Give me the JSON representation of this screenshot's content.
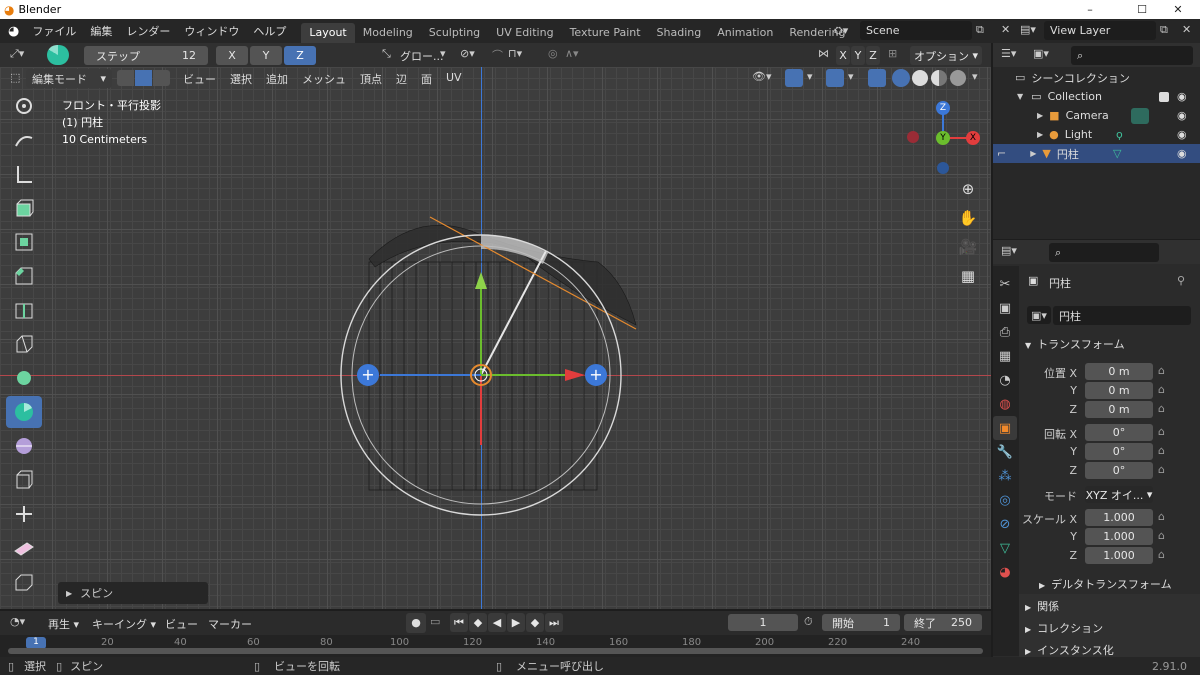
{
  "window": {
    "title": "Blender",
    "minimize": "–",
    "maximize": "☐",
    "close": "✕"
  },
  "menubar": {
    "items": [
      "ファイル",
      "編集",
      "レンダー",
      "ウィンドウ",
      "ヘルプ"
    ],
    "workspaces": [
      "Layout",
      "Modeling",
      "Sculpting",
      "UV Editing",
      "Texture Paint",
      "Shading",
      "Animation",
      "Rendering"
    ],
    "active_workspace": "Layout",
    "scene": "Scene",
    "view_layer": "View Layer"
  },
  "tool_settings": {
    "steps_label": "ステップ",
    "steps_value": "12",
    "axes": [
      "X",
      "Y",
      "Z"
    ],
    "active_axis": "Z",
    "orientation": "グロー...",
    "options": "オプション",
    "snap_axes": [
      "X",
      "Y",
      "Z"
    ]
  },
  "viewport_header": {
    "mode": "編集モード",
    "menus": [
      "ビュー",
      "選択",
      "追加",
      "メッシュ",
      "頂点",
      "辺",
      "面",
      "UV"
    ]
  },
  "viewport": {
    "view_name": "フロント・平行投影",
    "object_name": "(1) 円柱",
    "scale": "10 Centimeters",
    "gizmo": {
      "z": "Z",
      "y": "Y",
      "x": "X"
    },
    "last_op_panel": "スピン"
  },
  "outliner": {
    "scene_collection": "シーンコレクション",
    "items": [
      {
        "name": "Collection",
        "icon": "collection-icon"
      },
      {
        "name": "Camera",
        "icon": "camera-icon"
      },
      {
        "name": "Light",
        "icon": "light-icon"
      },
      {
        "name": "円柱",
        "icon": "mesh-icon"
      }
    ]
  },
  "properties": {
    "object_name_header": "円柱",
    "object_name_field": "円柱",
    "transform_header": "トランスフォーム",
    "location_label": "位置 X",
    "location": [
      "0 m",
      "0 m",
      "0 m"
    ],
    "rotation_label": "回転 X",
    "rotation": [
      "0°",
      "0°",
      "0°"
    ],
    "mode_label": "モード",
    "mode_value": "XYZ オイ...",
    "scale_label": "スケール X",
    "scale": [
      "1.000",
      "1.000",
      "1.000"
    ],
    "axis_y": "Y",
    "axis_z": "Z",
    "delta_transform": "デルタトランスフォーム",
    "sections": [
      "関係",
      "コレクション",
      "インスタンス化"
    ]
  },
  "timeline": {
    "playback": "再生",
    "keying": "キーイング",
    "view": "ビュー",
    "marker": "マーカー",
    "current_frame": "1",
    "start_label": "開始",
    "start": "1",
    "end_label": "終了",
    "end": "250",
    "ruler_current": "1",
    "ruler": [
      "20",
      "40",
      "60",
      "80",
      "100",
      "120",
      "140",
      "160",
      "180",
      "200",
      "220",
      "240"
    ]
  },
  "statusbar": {
    "select": "選択",
    "spin": "スピン",
    "rotate_view": "ビューを回転",
    "call_menu": "メニュー呼び出し",
    "version": "2.91.0"
  },
  "colors": {
    "accent": "#4772b3",
    "x_axis": "#e23d3d",
    "y_axis": "#6bbd2d",
    "z_axis": "#3c78d8"
  }
}
